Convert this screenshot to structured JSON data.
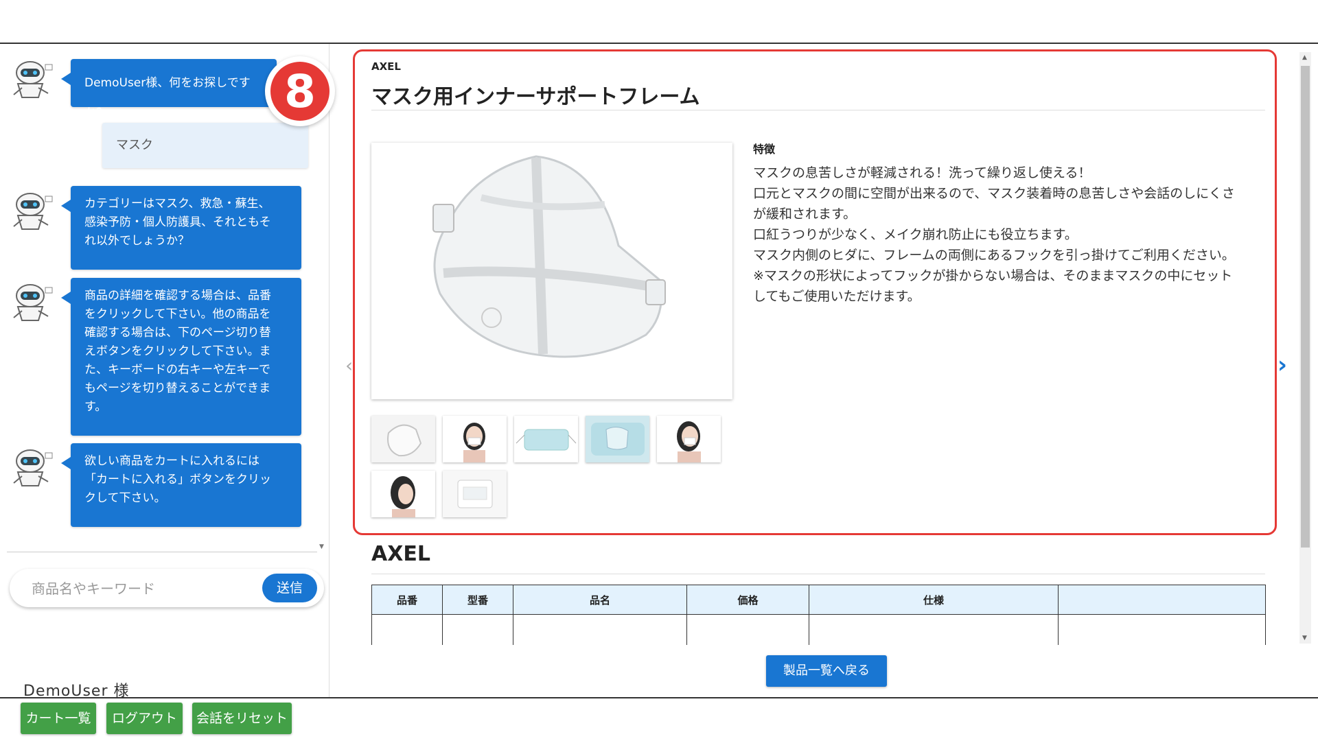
{
  "step_badge": "8",
  "chat": {
    "messages": [
      {
        "role": "bot",
        "text": "DemoUser様、何をお探しですか？"
      },
      {
        "role": "user",
        "text": "マスク"
      },
      {
        "role": "bot",
        "lines": [
          "カテゴリーはマスク、救急・蘇生、",
          "感染予防・個人防護具、それともそ",
          "れ以外でしょうか？"
        ]
      },
      {
        "role": "bot",
        "lines": [
          "商品の詳細を確認する場合は、品番",
          "をクリックして下さい。他の商品を",
          "確認する場合は、下のページ切り替",
          "えボタンをクリックして下さい。ま",
          "た、キーボードの右キーや左キーで",
          "もページを切り替えることができま",
          "す。"
        ]
      },
      {
        "role": "bot",
        "lines": [
          "欲しい商品をカートに入れるには",
          "「カートに入れる」ボタンをクリッ",
          "クして下さい。"
        ]
      }
    ],
    "input_placeholder": "商品名やキーワード",
    "send_label": "送信",
    "user_label": "DemoUser 様",
    "buttons": {
      "cart": "カート一覧",
      "logout": "ログアウト",
      "reset": "会話をリセット"
    }
  },
  "product": {
    "maker": "AXEL",
    "title": "マスク用インナーサポートフレーム",
    "features_heading": "特徴",
    "features_lines": [
      "マスクの息苦しさが軽減される！洗って繰り返し使える！",
      "口元とマスクの間に空間が出来るので、マスク装着時の息苦しさや会話のしにくさ",
      "が緩和されます。",
      "口紅うつりが少なく、メイク崩れ防止にも役立ちます。",
      "マスク内側のヒダに、フレームの両側にあるフックを引っ掛けてご利用ください。",
      "※マスクの形状によってフックが掛からない場合は、そのままマスクの中にセット",
      "してもご使用いただけます。"
    ],
    "thumbnail_count": 7
  },
  "spec_section": {
    "maker": "AXEL",
    "headers": [
      "品番",
      "型番",
      "品名",
      "価格",
      "仕様",
      ""
    ]
  },
  "back_button": "製品一覧へ戻る",
  "colors": {
    "accent_blue": "#1976d2",
    "green": "#43a047",
    "highlight_red": "#e53935"
  }
}
